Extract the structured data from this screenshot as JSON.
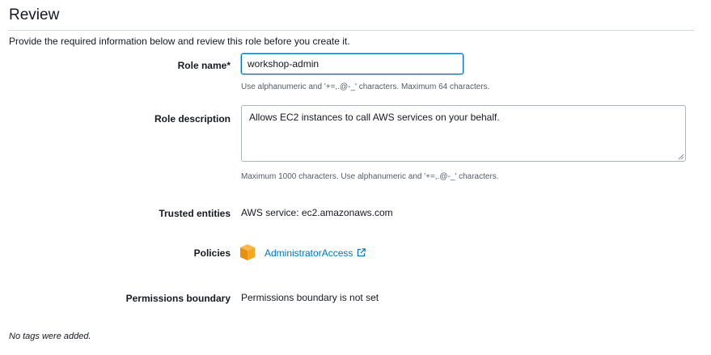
{
  "page": {
    "title": "Review",
    "intro": "Provide the required information below and review this role before you create it."
  },
  "role_name": {
    "label": "Role name*",
    "value": "workshop-admin",
    "hint": "Use alphanumeric and '+=,.@-_' characters. Maximum 64 characters."
  },
  "role_description": {
    "label": "Role description",
    "value": "Allows EC2 instances to call AWS services on your behalf.",
    "hint": "Maximum 1000 characters. Use alphanumeric and '+=,.@-_' characters."
  },
  "trusted_entities": {
    "label": "Trusted entities",
    "value": "AWS service: ec2.amazonaws.com"
  },
  "policies": {
    "label": "Policies",
    "items": [
      {
        "name": "AdministratorAccess",
        "icon": "policy-cube-icon",
        "link_icon": "external-link-icon"
      }
    ]
  },
  "permissions_boundary": {
    "label": "Permissions boundary",
    "value": "Permissions boundary is not set"
  },
  "tags": {
    "message": "No tags were added."
  },
  "colors": {
    "link": "#0073bb",
    "policy_icon": "#f5a623",
    "input_focus_border": "#0073bb"
  }
}
